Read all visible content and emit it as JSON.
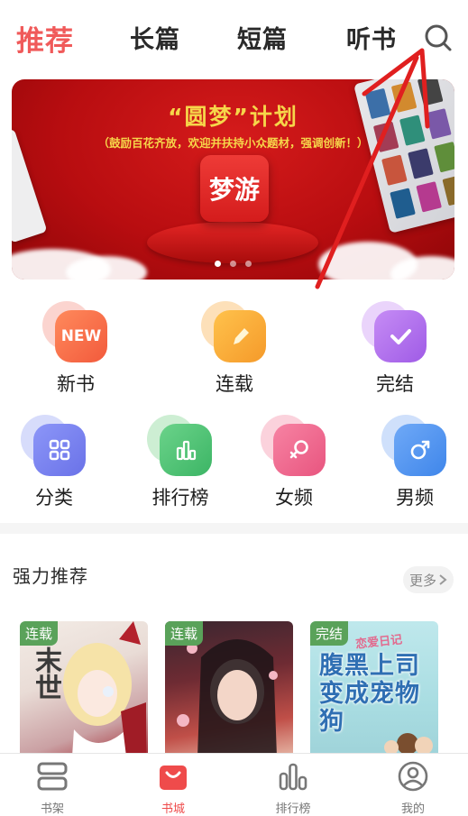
{
  "top_tabs": [
    {
      "label": "推荐",
      "active": true
    },
    {
      "label": "长篇",
      "active": false
    },
    {
      "label": "短篇",
      "active": false
    },
    {
      "label": "听书",
      "active": false
    }
  ],
  "banner": {
    "title": "“圆梦”计划",
    "subtitle": "（鼓励百花齐放，欢迎并扶持小众题材，强调创新！）",
    "logo_text": "梦游",
    "page_count": 3,
    "active_page": 1
  },
  "categories_row1": [
    {
      "label": "新书",
      "icon": "new-icon",
      "badge": "NEW"
    },
    {
      "label": "连载",
      "icon": "pencil-icon"
    },
    {
      "label": "完结",
      "icon": "check-icon"
    }
  ],
  "categories_row2": [
    {
      "label": "分类",
      "icon": "grid-icon"
    },
    {
      "label": "排行榜",
      "icon": "bar-chart-icon"
    },
    {
      "label": "女频",
      "icon": "female-icon"
    },
    {
      "label": "男频",
      "icon": "male-icon"
    }
  ],
  "section": {
    "title": "强力推荐",
    "more_label": "更多"
  },
  "books": [
    {
      "status": "连载",
      "cover_text": "末世"
    },
    {
      "status": "连载",
      "cover_text": ""
    },
    {
      "status": "完结",
      "cover_text": "腹黑上司变成宠物狗",
      "cover_tag": "恋爱日记"
    }
  ],
  "bottom_nav": [
    {
      "label": "书架",
      "icon": "bookshelf-icon",
      "active": false
    },
    {
      "label": "书城",
      "icon": "store-icon",
      "active": true
    },
    {
      "label": "排行榜",
      "icon": "ranking-icon",
      "active": false
    },
    {
      "label": "我的",
      "icon": "profile-icon",
      "active": false
    }
  ],
  "colors": {
    "accent": "#f05a5a",
    "banner_red": "#c01214",
    "banner_gold": "#f6d64a"
  }
}
